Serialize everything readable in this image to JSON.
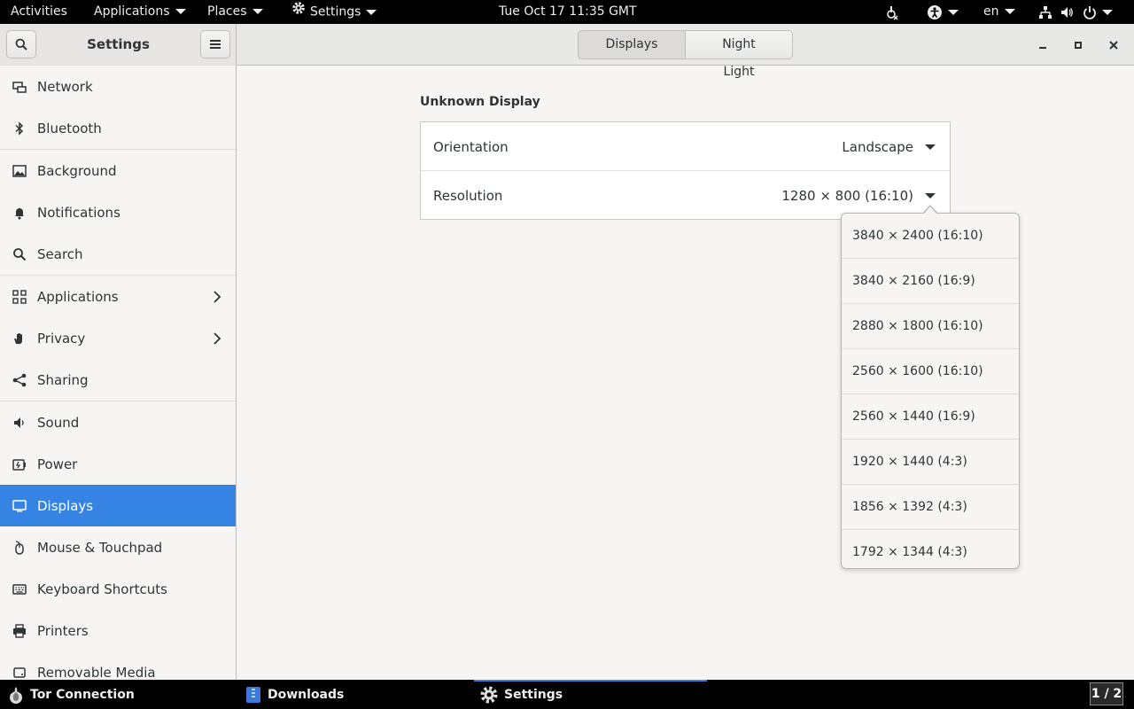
{
  "topbar": {
    "activities": "Activities",
    "applications": "Applications",
    "places": "Places",
    "settings": "Settings",
    "clock": "Tue Oct 17  11:35 GMT",
    "language": "en"
  },
  "window": {
    "sidebar_title": "Settings",
    "tabs": [
      "Displays",
      "Night Light"
    ]
  },
  "sidebar": {
    "items": [
      {
        "label": "Network",
        "icon": "network-icon"
      },
      {
        "label": "Bluetooth",
        "icon": "bluetooth-icon"
      },
      {
        "label": "Background",
        "icon": "background-icon"
      },
      {
        "label": "Notifications",
        "icon": "bell-icon"
      },
      {
        "label": "Search",
        "icon": "search-icon"
      },
      {
        "label": "Applications",
        "icon": "grid-icon"
      },
      {
        "label": "Privacy",
        "icon": "hand-icon"
      },
      {
        "label": "Sharing",
        "icon": "share-icon"
      },
      {
        "label": "Sound",
        "icon": "speaker-icon"
      },
      {
        "label": "Power",
        "icon": "power-icon"
      },
      {
        "label": "Displays",
        "icon": "display-icon"
      },
      {
        "label": "Mouse & Touchpad",
        "icon": "mouse-icon"
      },
      {
        "label": "Keyboard Shortcuts",
        "icon": "keyboard-icon"
      },
      {
        "label": "Printers",
        "icon": "printer-icon"
      },
      {
        "label": "Removable Media",
        "icon": "media-icon"
      }
    ],
    "selected": "Displays",
    "accent": "#3584e4"
  },
  "display": {
    "title": "Unknown Display",
    "orientation_label": "Orientation",
    "orientation_value": "Landscape",
    "resolution_label": "Resolution",
    "resolution_value": "1280 × 800 (16:10)"
  },
  "resolution_options": [
    "3840 × 2400 (16:10)",
    "3840 × 2160 (16:9)",
    "2880 × 1800 (16:10)",
    "2560 × 1600 (16:10)",
    "2560 × 1440 (16:9)",
    "1920 × 1440 (4:3)",
    "1856 × 1392 (4:3)",
    "1792 × 1344 (4:3)"
  ],
  "taskbar": {
    "tasks": [
      "Tor Connection",
      "Downloads",
      "Settings"
    ],
    "workspace": "1 / 2"
  }
}
